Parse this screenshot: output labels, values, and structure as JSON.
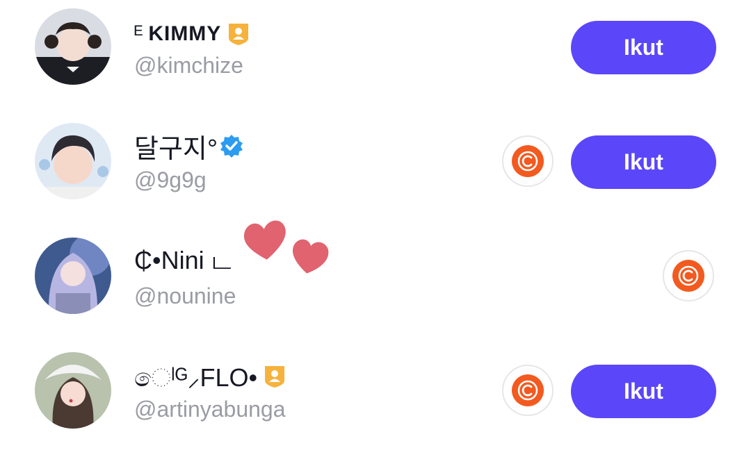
{
  "users": [
    {
      "display_name_prefix": "ᴱ",
      "display_name": "KIMMY",
      "handle": "@kimchize",
      "badge": "creator-badge-icon",
      "has_coin_button": false,
      "has_follow_button": true,
      "follow_label": "Ikut"
    },
    {
      "display_name_prefix": "",
      "display_name": "달구지°",
      "handle": "@9g9g",
      "badge": "verified-badge-icon",
      "has_coin_button": true,
      "has_follow_button": true,
      "follow_label": "Ikut"
    },
    {
      "display_name_prefix": "",
      "display_name": "₵•Nini ட",
      "handle": "@nounine",
      "badge": "",
      "has_coin_button": true,
      "has_follow_button": false,
      "follow_label": ""
    },
    {
      "display_name_prefix": "",
      "display_name": "ෙˡᴳ⸝FLO•",
      "handle": "@artinyabunga",
      "badge": "creator-badge-icon",
      "has_coin_button": true,
      "has_follow_button": true,
      "follow_label": "Ikut"
    }
  ],
  "colors": {
    "follow_button": "#5b46f9",
    "handle_text": "#9a9ca3",
    "name_text": "#161823",
    "coin": "#f25a1f",
    "verified": "#2c9cf0",
    "creator_badge": "#f6b23c",
    "heart": "#e0636f"
  },
  "sticker": "hearts-sticker"
}
